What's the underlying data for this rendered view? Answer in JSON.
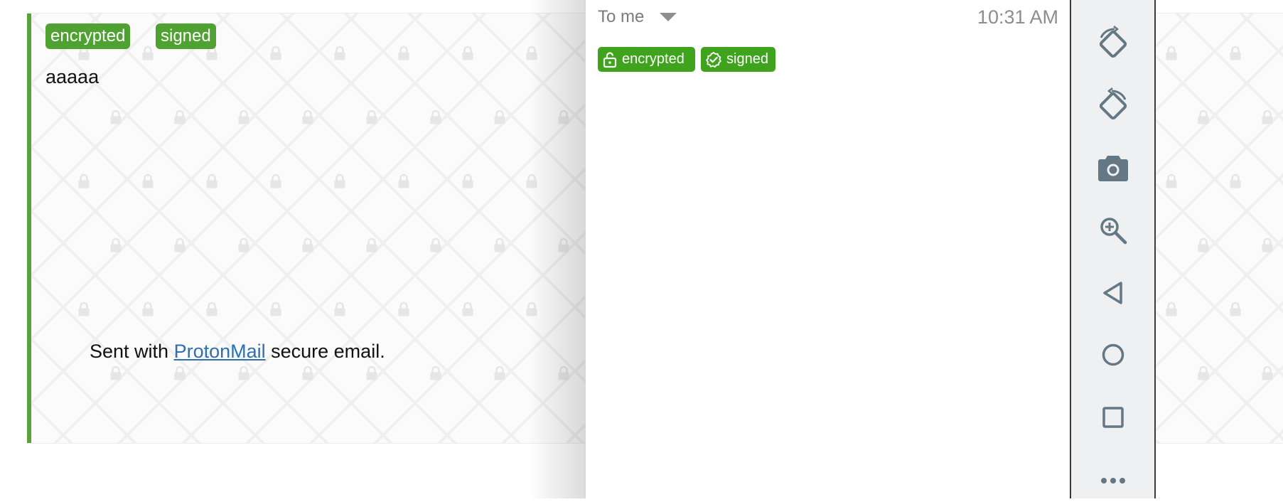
{
  "web_message": {
    "badges": [
      "encrypted",
      "signed"
    ],
    "body": "aaaaa",
    "signature_prefix": "Sent with ",
    "signature_link": "ProtonMail",
    "signature_suffix": " secure email.",
    "accent_color": "#5aa23a"
  },
  "app_message": {
    "recipient": "To me",
    "time": "10:31 AM",
    "badges": [
      {
        "label": "encrypted",
        "icon": "lock-icon"
      },
      {
        "label": "signed",
        "icon": "verified-check-icon"
      }
    ],
    "badge_color": "#3fa31e"
  },
  "emulator_toolbar": {
    "tools": [
      {
        "name": "rotate-left-icon"
      },
      {
        "name": "rotate-right-icon"
      },
      {
        "name": "camera-icon"
      },
      {
        "name": "zoom-in-icon"
      },
      {
        "name": "back-icon"
      },
      {
        "name": "home-icon"
      },
      {
        "name": "overview-icon"
      },
      {
        "name": "more-icon"
      }
    ]
  }
}
